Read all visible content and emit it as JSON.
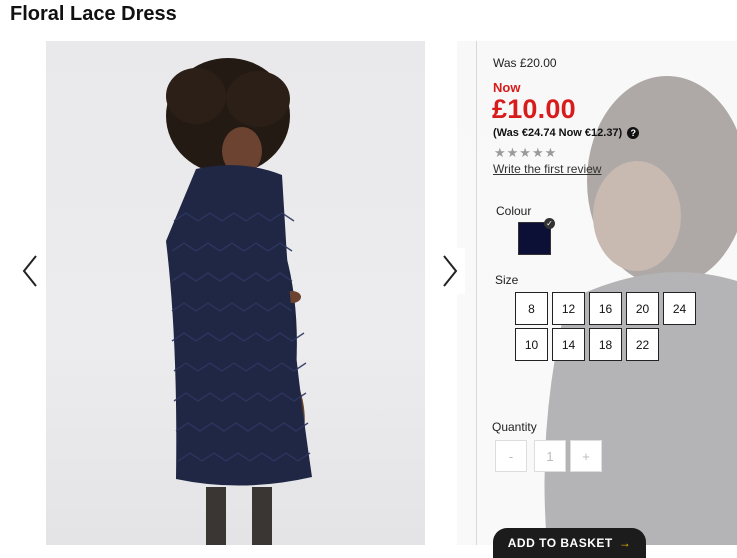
{
  "product": {
    "title": "Floral Lace Dress",
    "was_price": "Was £20.00",
    "now_label": "Now",
    "now_price": "£10.00",
    "euro_price": "(Was €24.74 Now €12.37)",
    "help_symbol": "?",
    "stars": "★★★★★",
    "review_link": "Write the first review"
  },
  "colour": {
    "label": "Colour",
    "selected_hex": "#0c1036",
    "check": "✓"
  },
  "sizes": {
    "label": "Size",
    "row1": [
      "8",
      "12",
      "16",
      "20",
      "24"
    ],
    "row2": [
      "10",
      "14",
      "18",
      "22"
    ]
  },
  "quantity": {
    "label": "Quantity",
    "minus": "-",
    "value": "1",
    "plus": "+"
  },
  "basket": {
    "label": "ADD TO BASKET",
    "arrow": "→"
  },
  "icons": {
    "prev": "chevron-left-icon",
    "next": "chevron-right-icon"
  }
}
